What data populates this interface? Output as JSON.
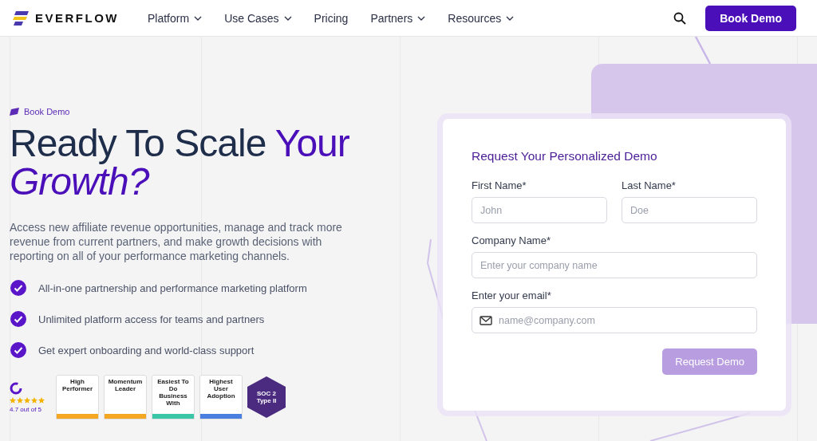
{
  "header": {
    "logo": "EVERFLOW",
    "nav": [
      {
        "label": "Platform",
        "dropdown": true
      },
      {
        "label": "Use Cases",
        "dropdown": true
      },
      {
        "label": "Pricing",
        "dropdown": false
      },
      {
        "label": "Partners",
        "dropdown": true
      },
      {
        "label": "Resources",
        "dropdown": true
      }
    ],
    "cta": "Book Demo"
  },
  "hero": {
    "eyebrow": "Book Demo",
    "headline": [
      "Ready To Scale ",
      "Your",
      "Growth?"
    ],
    "description": "Access new affiliate revenue opportunities, manage and track more revenue from current partners, and make growth decisions with reporting on all of your performance marketing channels.",
    "features": [
      "All-in-one partnership and performance marketing platform",
      "Unlimited platform access for teams and partners",
      "Get expert onboarding and world-class support"
    ],
    "rating": {
      "stars": 5,
      "text": "4.7 out of 5"
    },
    "badges": [
      {
        "kind": "g2",
        "title": "High Performer",
        "color": "#f5a623"
      },
      {
        "kind": "g2",
        "title": "Momentum Leader",
        "color": "#f5a623"
      },
      {
        "kind": "g2",
        "title": "Easiest To Do Business With",
        "color": "#3cc6a8"
      },
      {
        "kind": "g2",
        "title": "Highest User Adoption",
        "color": "#4a7fe0"
      },
      {
        "kind": "soc",
        "title": "SOC 2 Type II",
        "color": "#4b2b7f"
      }
    ]
  },
  "form": {
    "title": "Request Your Personalized Demo",
    "fields": [
      {
        "label": "First Name*",
        "placeholder": "John",
        "icon": false
      },
      {
        "label": "Last Name*",
        "placeholder": "Doe",
        "icon": false
      },
      {
        "label": "Company Name*",
        "placeholder": "Enter your company name",
        "icon": false
      },
      {
        "label": "Enter your email*",
        "placeholder": "name@company.com",
        "icon": true
      }
    ],
    "submit": {
      "label": "Request Demo",
      "disabled": true
    }
  }
}
